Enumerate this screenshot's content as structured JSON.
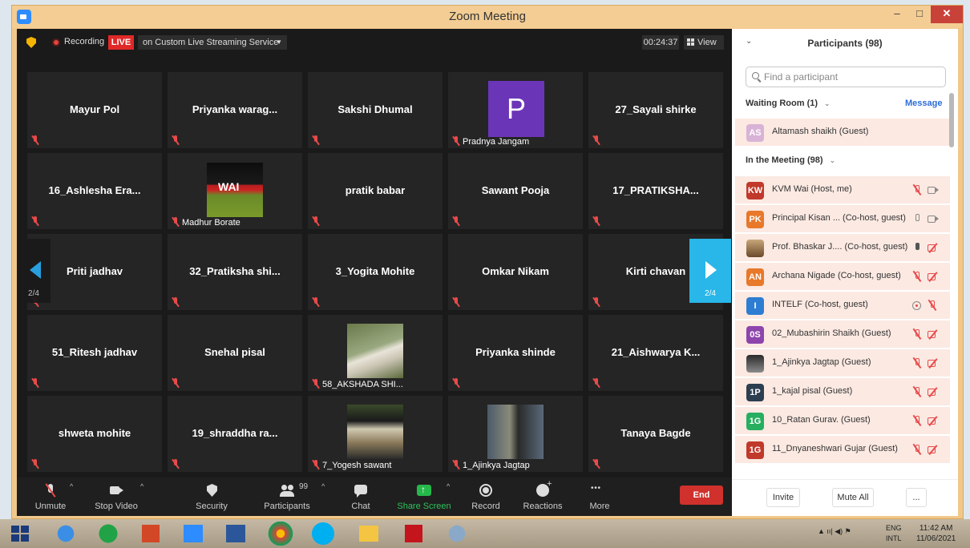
{
  "window": {
    "title": "Zoom Meeting",
    "min": "–",
    "max": "□",
    "close": "✕"
  },
  "topbar": {
    "recording": "Recording",
    "live": "LIVE",
    "stream": "on Custom Live Streaming Service",
    "timer": "00:24:37",
    "view": "View"
  },
  "tiles": [
    {
      "name": "Mayur Pol"
    },
    {
      "name": "Priyanka  warag..."
    },
    {
      "name": "Sakshi Dhumal"
    },
    {
      "name": "Pradnya Jangam",
      "avatar_letter": "P"
    },
    {
      "name": "27_Sayali shirke"
    },
    {
      "name": "16_Ashlesha  Era..."
    },
    {
      "name": "Madhur Borate"
    },
    {
      "name": "pratik babar"
    },
    {
      "name": "Sawant Pooja"
    },
    {
      "name": "17_PRATIKSHA..."
    },
    {
      "name": "Priti jadhav"
    },
    {
      "name": "32_Pratiksha  shi..."
    },
    {
      "name": "3_Yogita Mohite"
    },
    {
      "name": "Omkar Nikam"
    },
    {
      "name": "Kirti chavan"
    },
    {
      "name": "51_Ritesh jadhav"
    },
    {
      "name": "Snehal pisal"
    },
    {
      "name": "58_AKSHADA SHI..."
    },
    {
      "name": "Priyanka shinde"
    },
    {
      "name": "21_Aishwarya  K..."
    },
    {
      "name": "shweta mohite"
    },
    {
      "name": "19_shraddha  ra..."
    },
    {
      "name": "7_Yogesh sawant"
    },
    {
      "name": "1_Ajinkya Jagtap"
    },
    {
      "name": "Tanaya Bagde"
    }
  ],
  "thumb_text": "WAI",
  "pager": {
    "left": "2/4",
    "right": "2/4"
  },
  "toolbar": {
    "unmute": "Unmute",
    "stop_video": "Stop Video",
    "security": "Security",
    "participants": "Participants",
    "participants_count": "99",
    "chat": "Chat",
    "share": "Share Screen",
    "record": "Record",
    "reactions": "Reactions",
    "more": "More",
    "end": "End"
  },
  "participants": {
    "title": "Participants (98)",
    "search_placeholder": "Find a participant",
    "waiting_room": "Waiting Room (1)",
    "message": "Message",
    "waiting": [
      {
        "initials": "AS",
        "name": "Altamash shaikh (Guest)",
        "color": "#d8b3d6"
      }
    ],
    "in_meeting": "In the Meeting (98)",
    "list": [
      {
        "initials": "KW",
        "name": "KVM Wai (Host, me)",
        "color": "#c0392b",
        "mic": "muted",
        "cam": "on"
      },
      {
        "initials": "PK",
        "name": "Principal Kisan ... (Co-host, guest)",
        "color": "#e8782a",
        "mic": "on",
        "cam": "on"
      },
      {
        "initials": "",
        "name": "Prof. Bhaskar J.... (Co-host, guest)",
        "color": "#8a6a4a",
        "mic": "live",
        "cam": "off"
      },
      {
        "initials": "AN",
        "name": "Archana Nigade (Co-host, guest)",
        "color": "#e8782a",
        "mic": "muted",
        "cam": "off"
      },
      {
        "initials": "I",
        "name": "INTELF (Co-host, guest)",
        "color": "#2d7dd2",
        "mic": "share",
        "cam": "mutedmic"
      },
      {
        "initials": "0S",
        "name": "02_Mubashirin Shaikh (Guest)",
        "color": "#8e44ad",
        "mic": "muted",
        "cam": "off"
      },
      {
        "initials": "",
        "name": "1_Ajinkya Jagtap (Guest)",
        "color": "#3a3a3a",
        "mic": "muted",
        "cam": "off"
      },
      {
        "initials": "1P",
        "name": "1_kajal pisal (Guest)",
        "color": "#2c3e50",
        "mic": "muted",
        "cam": "off"
      },
      {
        "initials": "1G",
        "name": "10_Ratan Gurav. (Guest)",
        "color": "#27ae60",
        "mic": "muted",
        "cam": "off"
      },
      {
        "initials": "1G",
        "name": "11_Dnyaneshwari Gujar (Guest)",
        "color": "#c0392b",
        "mic": "muted",
        "cam": "off"
      }
    ],
    "invite": "Invite",
    "mute_all": "Mute All",
    "more": "..."
  },
  "taskbar": {
    "lang1": "ENG",
    "lang2": "INTL",
    "time": "11:42 AM",
    "date": "11/06/2021"
  }
}
